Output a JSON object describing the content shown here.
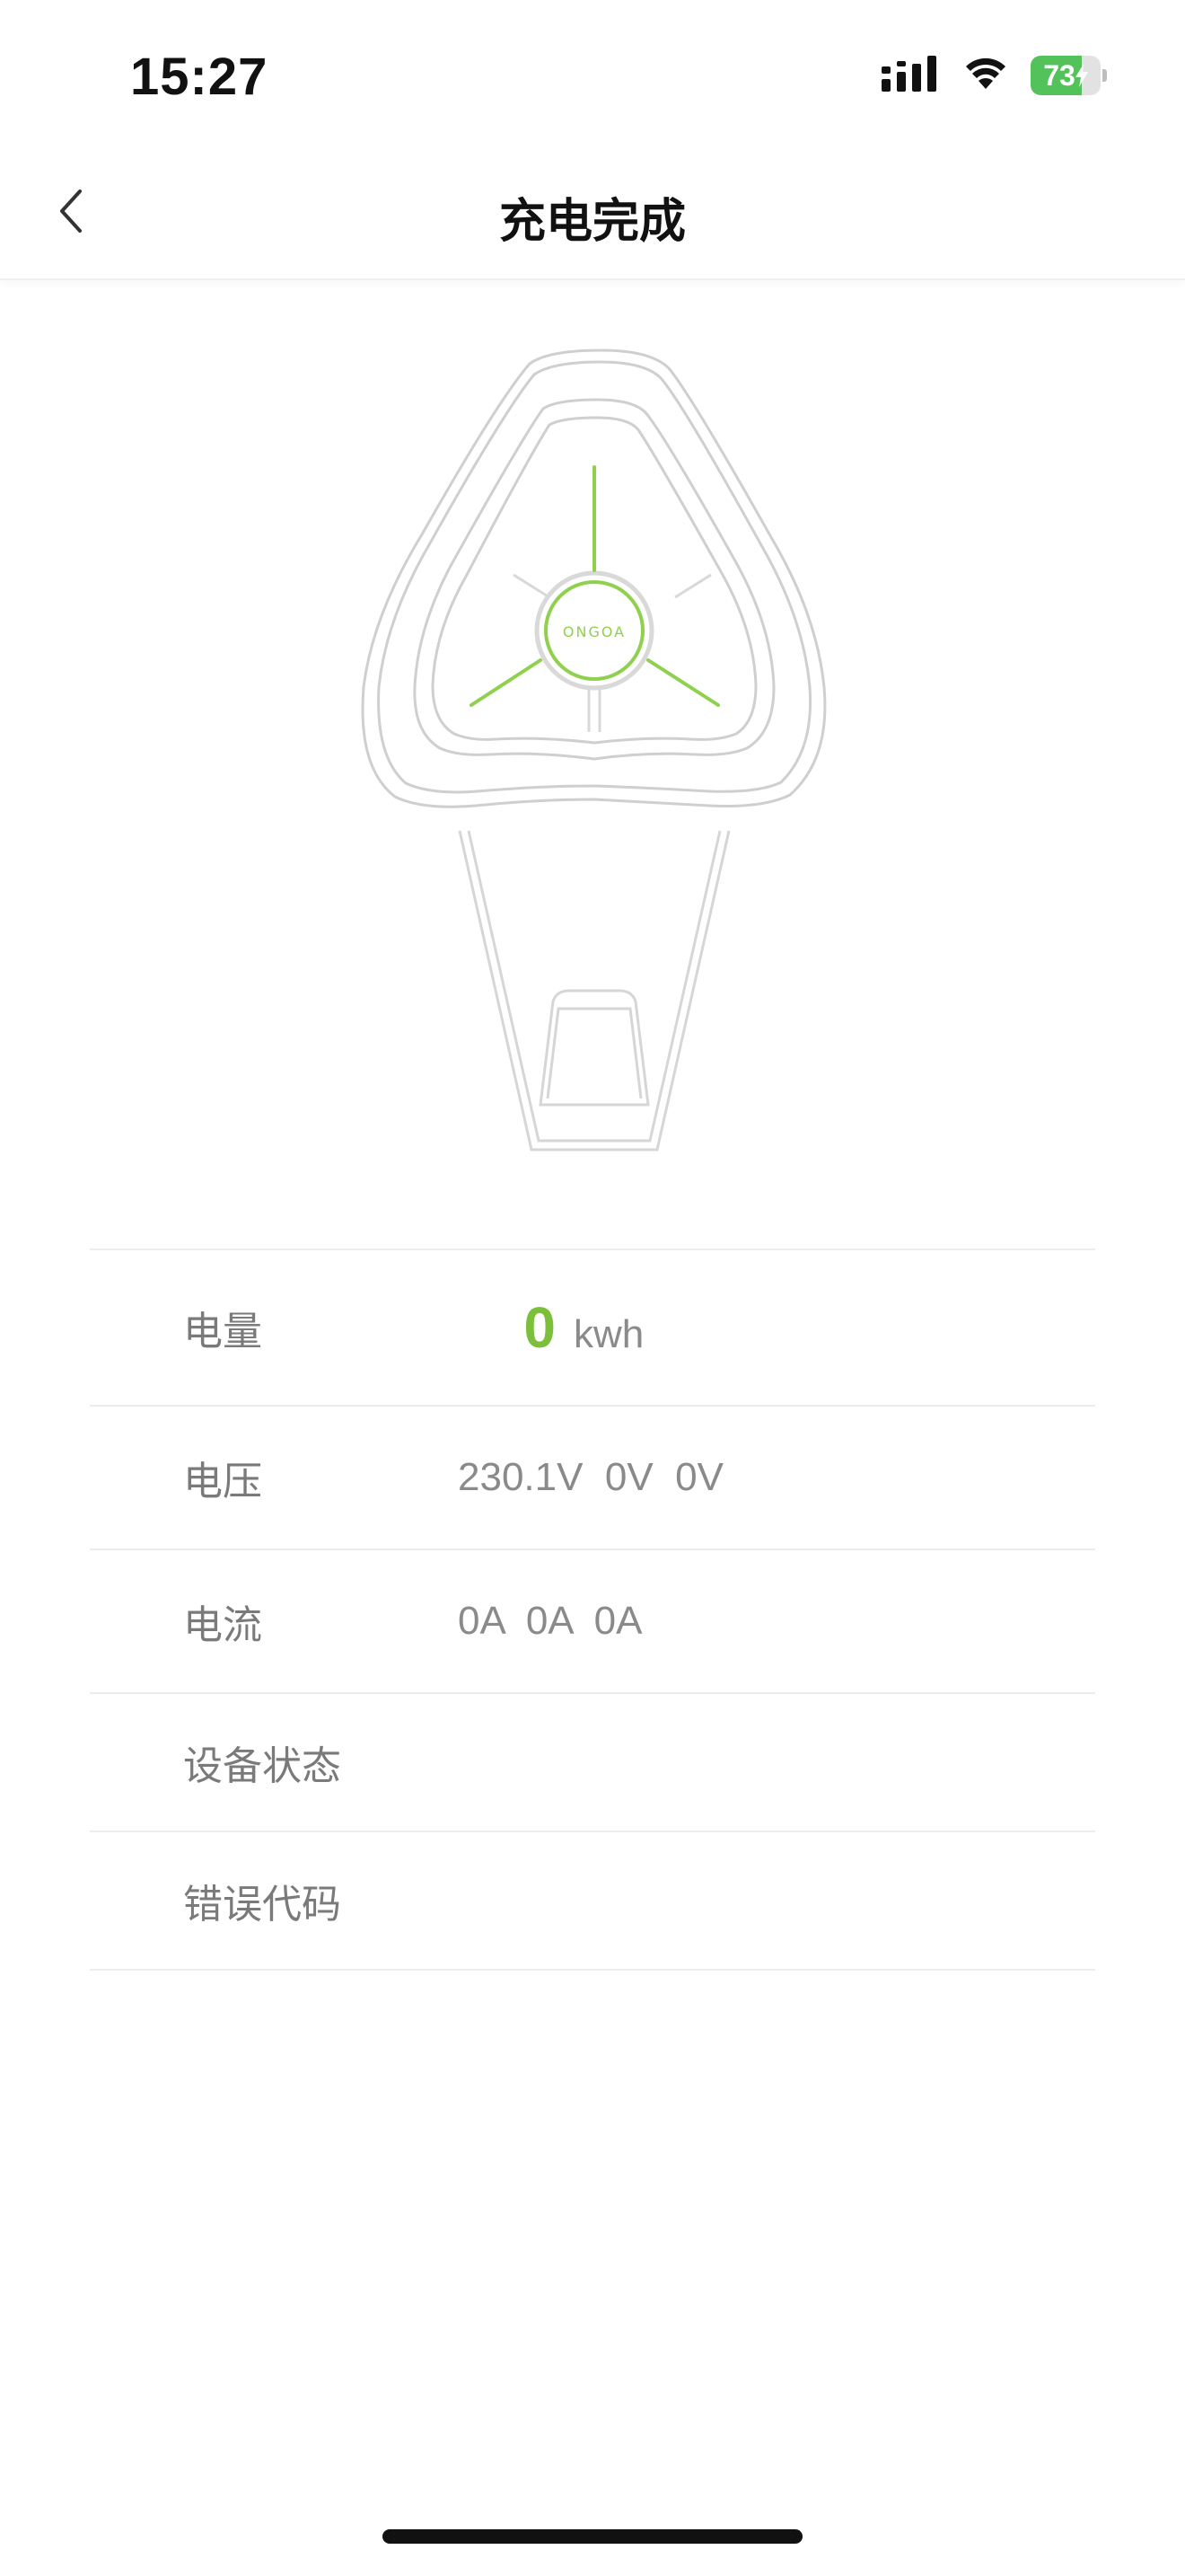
{
  "status_bar": {
    "time": "15:27",
    "battery_level": "73",
    "battery_fraction": 0.73,
    "signal_icon": "cellular-signal-icon",
    "wifi_icon": "wifi-icon",
    "charging_icon": "charging-bolt-icon"
  },
  "nav": {
    "title": "充电完成",
    "back_icon": "chevron-left-icon"
  },
  "charger": {
    "brand_text": "ONGOA",
    "accent_color": "#8fd14f"
  },
  "info": {
    "energy": {
      "label": "电量",
      "value": "0",
      "unit": "kwh"
    },
    "voltage": {
      "label": "电压",
      "value": "230.1V  0V  0V"
    },
    "current": {
      "label": "电流",
      "value": "0A  0A  0A"
    },
    "device_status": {
      "label": "设备状态",
      "value": ""
    },
    "error_code": {
      "label": "错误代码",
      "value": ""
    }
  },
  "colors": {
    "accent_green": "#7cbf3a",
    "label_gray": "#7a7a7a",
    "divider": "#ececec",
    "battery_green": "#54c25a"
  }
}
